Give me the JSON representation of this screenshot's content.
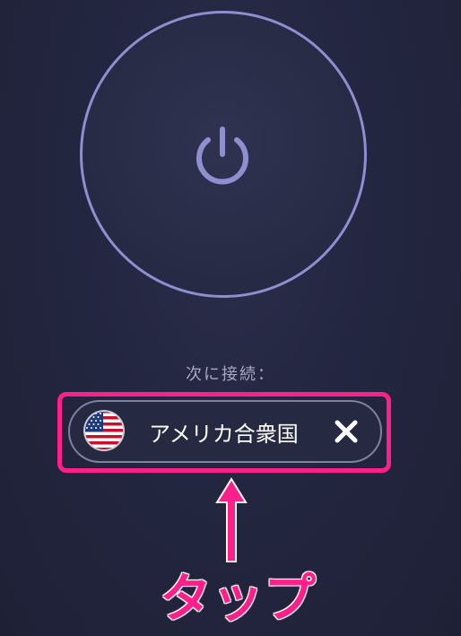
{
  "next_connection": {
    "label": "次に接続：",
    "country": "アメリカ合衆国",
    "flag_icon": "us-flag-icon",
    "remove_icon": "close-icon"
  },
  "power_button": {
    "icon": "power-icon"
  },
  "annotation": {
    "text": "タップ",
    "color": "#ff1f8a"
  },
  "colors": {
    "ring": "#8e8fd0",
    "background": "#23263f"
  }
}
